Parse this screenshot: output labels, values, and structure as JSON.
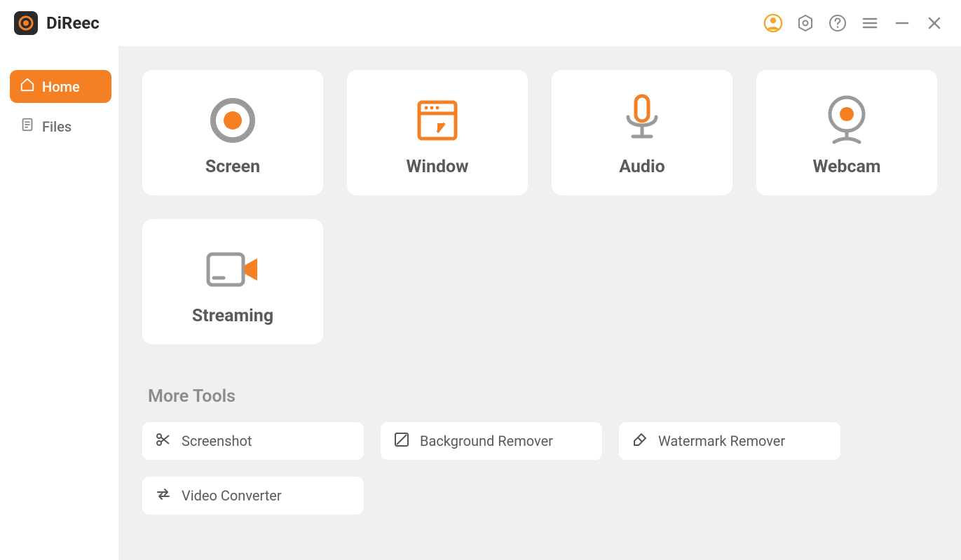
{
  "app": {
    "name": "DiReec"
  },
  "sidebar": {
    "items": [
      {
        "label": "Home",
        "active": true
      },
      {
        "label": "Files",
        "active": false
      }
    ]
  },
  "main": {
    "cards": [
      {
        "label": "Screen"
      },
      {
        "label": "Window"
      },
      {
        "label": "Audio"
      },
      {
        "label": "Webcam"
      },
      {
        "label": "Streaming"
      }
    ],
    "moreToolsTitle": "More Tools",
    "tools": [
      {
        "label": "Screenshot"
      },
      {
        "label": "Background Remover"
      },
      {
        "label": "Watermark Remover"
      },
      {
        "label": "Video Converter"
      }
    ]
  }
}
